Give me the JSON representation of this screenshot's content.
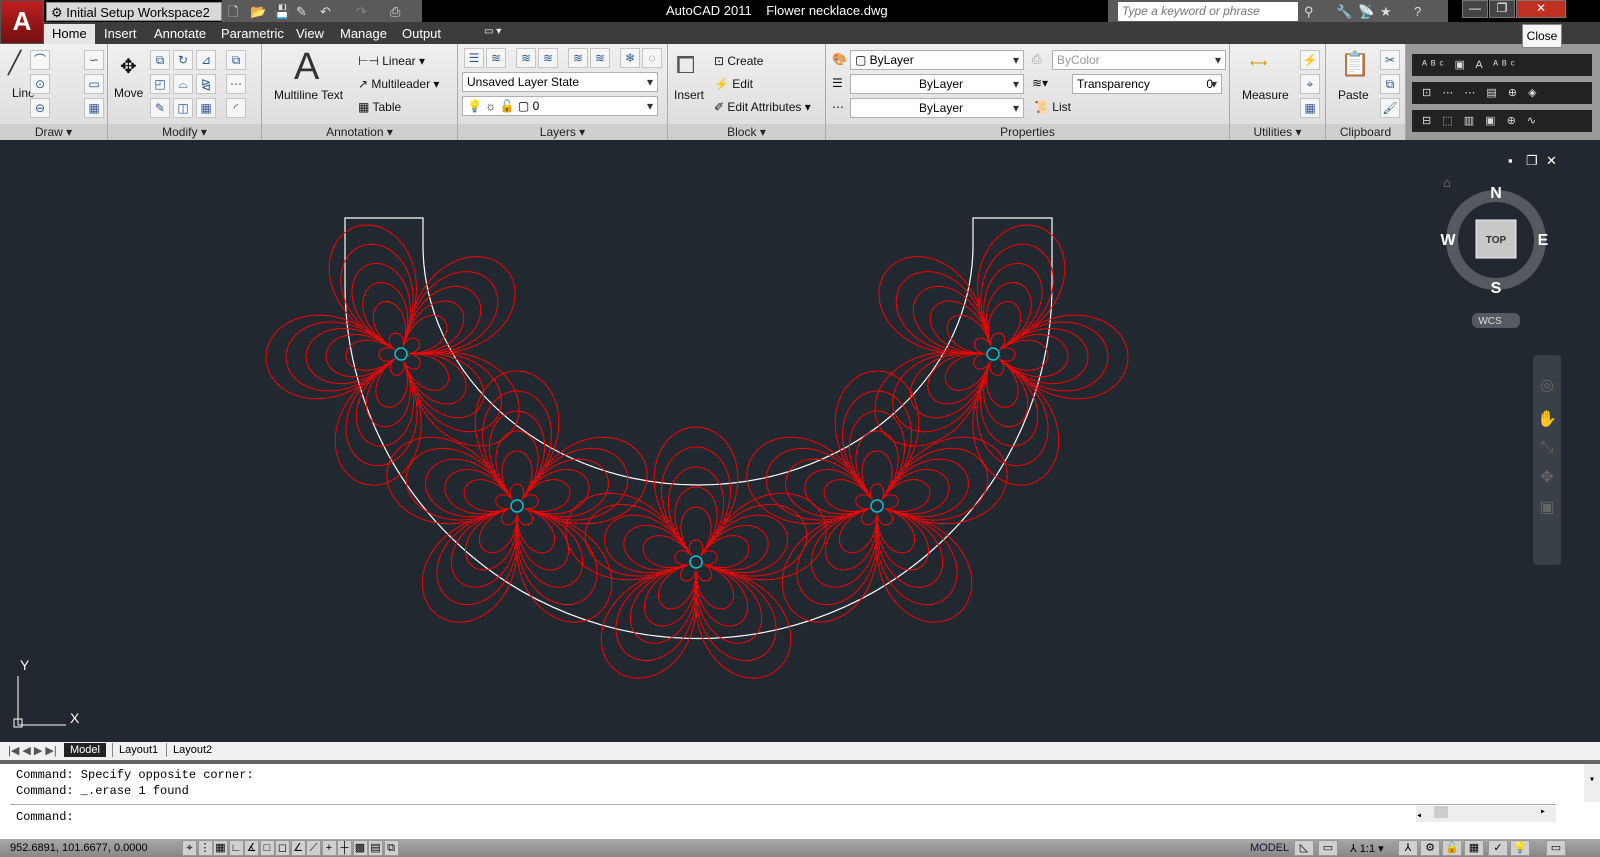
{
  "app": {
    "logo": "A",
    "title": "AutoCAD 2011    Flower necklace.dwg",
    "workspace": "Initial Setup Workspace2",
    "search_placeholder": "Type a keyword or phrase",
    "tooltip": "Close"
  },
  "tabs": [
    "Home",
    "Insert",
    "Annotate",
    "Parametric",
    "View",
    "Manage",
    "Output"
  ],
  "ribbon": {
    "draw": {
      "title": "Draw",
      "line": "Line"
    },
    "modify": {
      "title": "Modify",
      "move": "Move"
    },
    "annotation": {
      "title": "Annotation",
      "multiline_text": "Multiline Text",
      "linear": "Linear",
      "multileader": "Multileader",
      "table": "Table"
    },
    "layers": {
      "title": "Layers",
      "layer_state": "Unsaved Layer State",
      "current_layer": "0"
    },
    "block": {
      "title": "Block",
      "insert": "Insert",
      "create": "Create",
      "edit": "Edit",
      "edit_attributes": "Edit Attributes"
    },
    "properties": {
      "title": "Properties",
      "color": "ByLayer",
      "lineweight": "ByLayer",
      "linetype": "ByLayer",
      "plot_style": "ByColor",
      "transparency_label": "Transparency",
      "transparency_value": "0",
      "list": "List"
    },
    "utilities": {
      "title": "Utilities",
      "measure": "Measure"
    },
    "clipboard": {
      "title": "Clipboard",
      "paste": "Paste"
    }
  },
  "viewcube": {
    "n": "N",
    "s": "S",
    "e": "E",
    "w": "W",
    "face": "TOP",
    "ucs": "WCS"
  },
  "ucs_icon": {
    "x": "X",
    "y": "Y"
  },
  "drawing": {
    "colors": {
      "background": "#212830",
      "flowers": "#ff0000",
      "centers": "#00c8d8",
      "outline": "#ffffff"
    },
    "flower_count": 5
  },
  "layout_tabs": [
    "Model",
    "Layout1",
    "Layout2"
  ],
  "command": {
    "history": [
      "Command: Specify opposite corner:",
      "Command: _.erase 1 found"
    ],
    "prompt": "Command:"
  },
  "status": {
    "coordinates": "952.6891, 101.6677, 0.0000",
    "model": "MODEL",
    "scale": "1:1"
  }
}
